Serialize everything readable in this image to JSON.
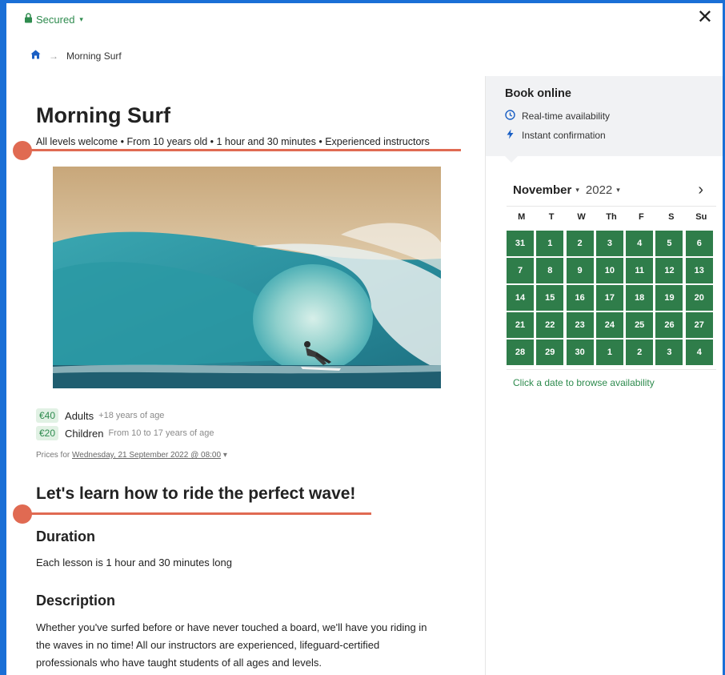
{
  "topbar": {
    "secured_label": "Secured",
    "close_icon": "close-icon"
  },
  "breadcrumb": {
    "home_icon": "home-icon",
    "current": "Morning Surf"
  },
  "main": {
    "title": "Morning Surf",
    "subtitle": "All levels welcome • From 10 years old • 1 hour and 30 minutes • Experienced instructors",
    "prices": [
      {
        "badge": "€40",
        "label": "Adults",
        "note": "+18 years of age"
      },
      {
        "badge": "€20",
        "label": "Children",
        "note": "From 10 to 17 years of age"
      }
    ],
    "prices_for_label": "Prices for",
    "prices_for_date": "Wednesday, 21 September 2022 @ 08:00",
    "heading": "Let's learn how to ride the perfect wave!",
    "duration_heading": "Duration",
    "duration_text": "Each lesson is 1 hour and 30 minutes long",
    "description_heading": "Description",
    "description_lines": [
      "Whether you've surfed before or have never touched a board, we'll have you riding in",
      "the waves in no time! All our instructors are experienced, lifeguard-certified",
      "professionals who have taught students of all ages and levels."
    ]
  },
  "booking": {
    "title": "Book online",
    "features": [
      {
        "icon": "clock-icon",
        "text": "Real-time availability"
      },
      {
        "icon": "lightning-icon",
        "text": "Instant confirmation"
      }
    ],
    "calendar": {
      "month": "November",
      "year": "2022",
      "weekdays": [
        "M",
        "T",
        "W",
        "Th",
        "F",
        "S",
        "Su"
      ],
      "days": [
        "31",
        "1",
        "2",
        "3",
        "4",
        "5",
        "6",
        "7",
        "8",
        "9",
        "10",
        "11",
        "12",
        "13",
        "14",
        "15",
        "16",
        "17",
        "18",
        "19",
        "20",
        "21",
        "22",
        "23",
        "24",
        "25",
        "26",
        "27",
        "28",
        "29",
        "30",
        "1",
        "2",
        "3",
        "4"
      ],
      "day_color": "#2f7d4a"
    },
    "hint": "Click a date to browse availability"
  },
  "annotation_color": "#e06a52",
  "accent": "#1a6fd6"
}
